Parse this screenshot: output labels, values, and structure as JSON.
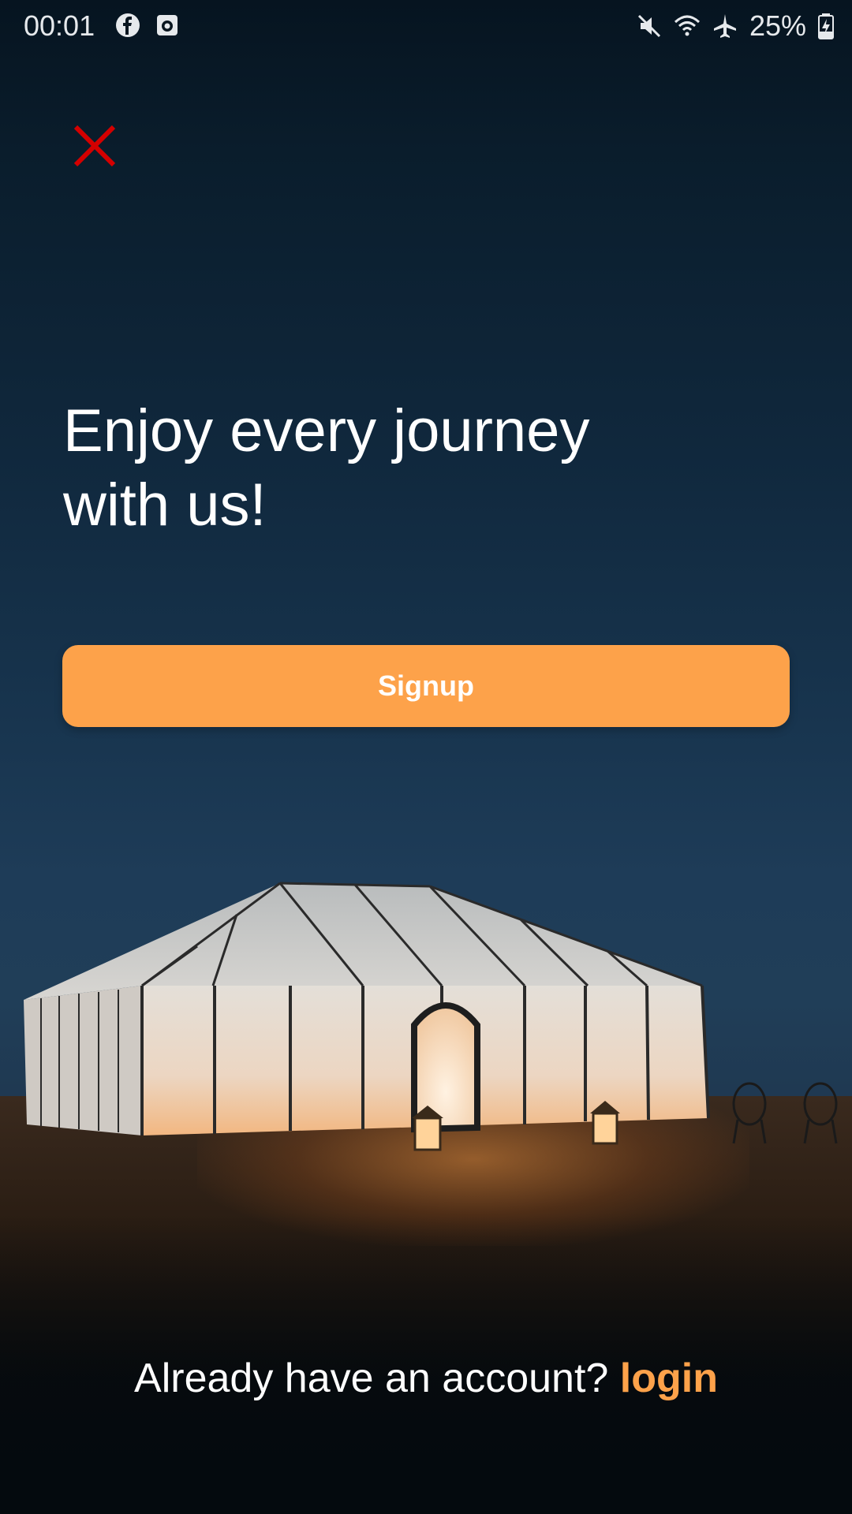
{
  "status_bar": {
    "time": "00:01",
    "battery": "25%",
    "icons": [
      "facebook-icon",
      "screen-record-icon",
      "mute-icon",
      "wifi-icon",
      "airplane-icon",
      "battery-charging-icon"
    ]
  },
  "close": {
    "icon": "close-icon",
    "color": "#d40000"
  },
  "headline": {
    "line1": "Enjoy every journey",
    "line2": "with us!"
  },
  "signup": {
    "label": "Signup",
    "color": "#fda24a"
  },
  "login": {
    "prompt": "Already have an account?",
    "link_label": "login",
    "link_color": "#fda24a"
  }
}
